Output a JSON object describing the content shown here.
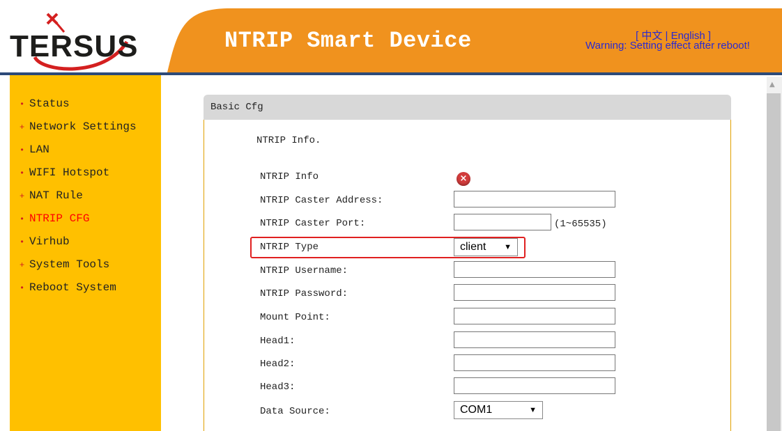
{
  "header": {
    "logo_text": "TERSUS",
    "title": "NTRIP Smart Device",
    "language_links": "[ 中文 | English ]",
    "warning": "Warning: Setting effect after reboot!"
  },
  "sidebar": {
    "items": [
      {
        "label": "Status",
        "bullet": "•"
      },
      {
        "label": "Network Settings",
        "bullet": "+"
      },
      {
        "label": "LAN",
        "bullet": "•"
      },
      {
        "label": "WIFI Hotspot",
        "bullet": "•"
      },
      {
        "label": "NAT Rule",
        "bullet": "+"
      },
      {
        "label": "NTRIP CFG",
        "bullet": "•"
      },
      {
        "label": "Virhub",
        "bullet": "•"
      },
      {
        "label": "System Tools",
        "bullet": "+"
      },
      {
        "label": "Reboot System",
        "bullet": "•"
      }
    ]
  },
  "panel": {
    "title": "Basic Cfg",
    "section": "NTRIP Info.",
    "fields": {
      "ntrip_info": "NTRIP Info",
      "caster_address": "NTRIP Caster Address:",
      "caster_port": "NTRIP Caster Port:",
      "port_hint": "(1~65535)",
      "ntrip_type": "NTRIP Type",
      "ntrip_type_value": "client",
      "username": "NTRIP Username:",
      "password": "NTRIP Password:",
      "mount_point": "Mount Point:",
      "head1": "Head1:",
      "head2": "Head2:",
      "head3": "Head3:",
      "data_source": "Data Source:",
      "data_source_value": "COM1"
    },
    "values": {
      "caster_address": "",
      "caster_port": "",
      "username": "",
      "password": "",
      "mount_point": "",
      "head1": "",
      "head2": "",
      "head3": ""
    }
  },
  "colors": {
    "header_orange": "#f0921e",
    "sidebar_yellow": "#ffc000",
    "active_menu": "#ff0000",
    "highlight": "#e02020",
    "link_blue": "#2a2ad0"
  }
}
